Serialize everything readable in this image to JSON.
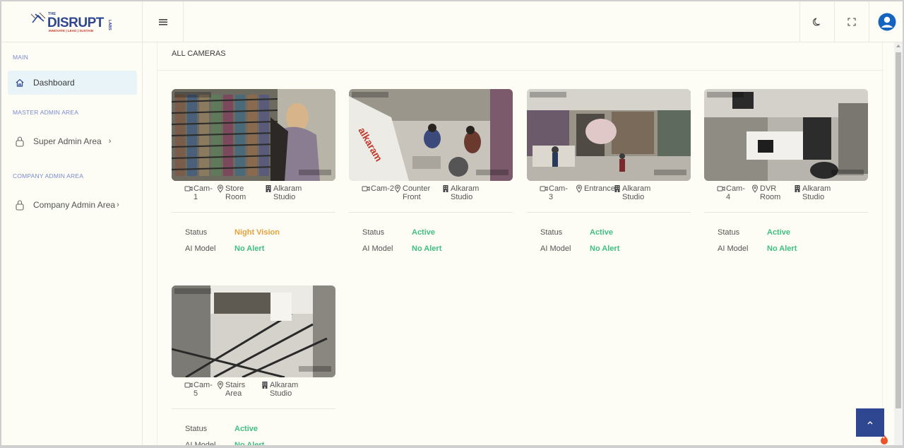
{
  "brand": {
    "the": "THE",
    "name": "DISRUPT",
    "labs": "LABS",
    "tagline": "INNOVATE | LEAD | SUSTAIN"
  },
  "topbar": {
    "menu_icon": "hamburger-icon",
    "theme_icon": "moon-icon",
    "fullscreen_icon": "fullscreen-icon",
    "avatar_icon": "user-avatar-icon"
  },
  "sidebar": {
    "main_heading": "MAIN",
    "dashboard": "Dashboard",
    "master_heading": "MASTER ADMIN AREA",
    "super_admin": "Super Admin Area",
    "company_heading": "COMPANY ADMIN AREA",
    "company_admin": "Company Admin Area",
    "chevron": "›"
  },
  "panel": {
    "title": "ALL CAMERAS"
  },
  "labels": {
    "status": "Status",
    "ai_model": "AI Model"
  },
  "cameras": [
    {
      "cam": "Cam-\n1",
      "location": "Store\nRoom",
      "company": "Alkaram\nStudio",
      "status": "Night Vision",
      "ai": "No Alert",
      "status_color": "#e6a23c"
    },
    {
      "cam": "Cam-2",
      "location": "Counter\nFront",
      "company": "Alkaram\nStudio",
      "status": "Active",
      "ai": "No Alert",
      "status_color": "#3fbf82"
    },
    {
      "cam": "Cam-\n3",
      "location": "Entrance",
      "company": "Alkaram\nStudio",
      "status": "Active",
      "ai": "No Alert",
      "status_color": "#3fbf82"
    },
    {
      "cam": "Cam-\n4",
      "location": "DVR\nRoom",
      "company": "Alkaram\nStudio",
      "status": "Active",
      "ai": "No Alert",
      "status_color": "#3fbf82"
    },
    {
      "cam": "Cam-\n5",
      "location": "Stairs\nArea",
      "company": "Alkaram\nStudio",
      "status": "Active",
      "ai": "No Alert",
      "status_color": "#3fbf82"
    }
  ],
  "colors": {
    "accent": "#2f4790",
    "active": "#3fbf82",
    "night_vision": "#e6a23c"
  },
  "scroll_top_icon": "chevron-up-icon"
}
